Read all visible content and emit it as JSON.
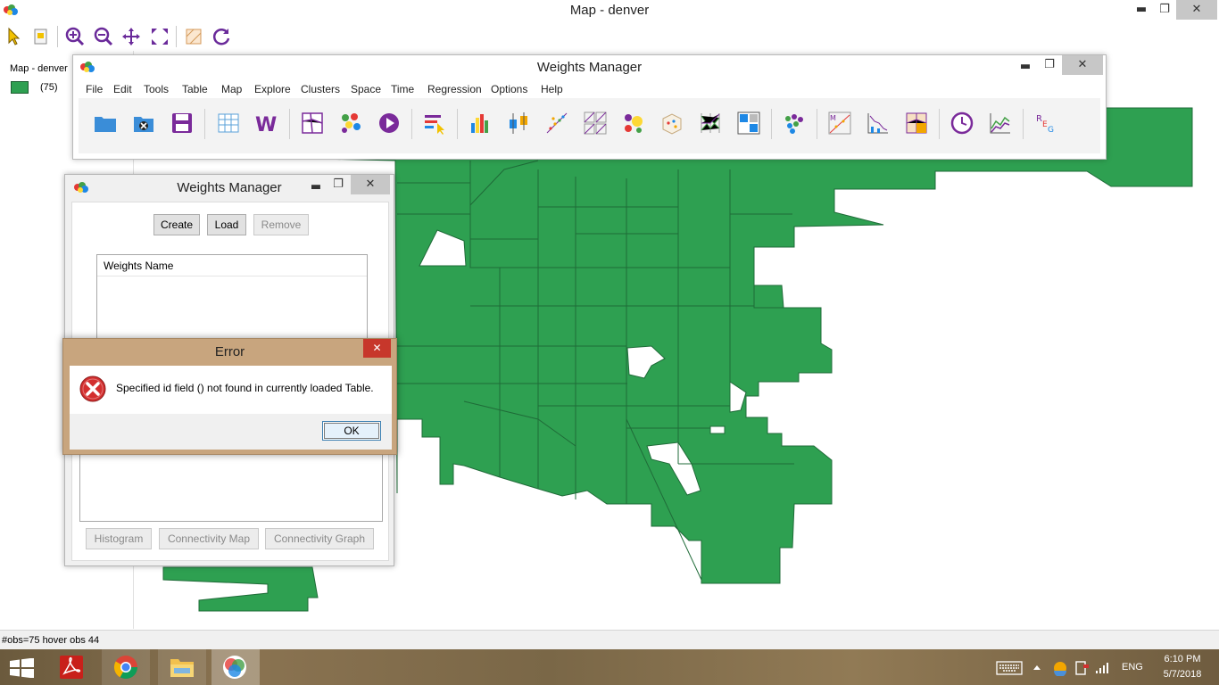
{
  "main_window": {
    "title": "Map - denver",
    "minimize": "▬",
    "restore": "❐",
    "close": "✕"
  },
  "legend": {
    "title": "Map - denver",
    "count": "(75)",
    "swatch_color": "#2ea051"
  },
  "status_bar": {
    "text": "#obs=75 hover obs 44"
  },
  "weights_manager_toolbar": {
    "title": "Weights Manager",
    "minimize": "▬",
    "restore": "❐",
    "close": "✕",
    "menu": [
      "File",
      "Edit",
      "Tools",
      "Table",
      "Map",
      "Explore",
      "Clusters",
      "Space",
      "Time",
      "Regression",
      "Options",
      "Help"
    ]
  },
  "weights_manager_dialog": {
    "title": "Weights Manager",
    "minimize": "▬",
    "restore": "❐",
    "close": "✕",
    "create_label": "Create",
    "load_label": "Load",
    "remove_label": "Remove",
    "list_header": "Weights Name",
    "histogram_label": "Histogram",
    "connectivity_map_label": "Connectivity Map",
    "connectivity_graph_label": "Connectivity Graph"
  },
  "error_dialog": {
    "title": "Error",
    "close": "✕",
    "message": "Specified id field () not found in currently loaded Table.",
    "ok_label": "OK"
  },
  "taskbar": {
    "language": "ENG",
    "time": "6:10 PM",
    "date": "5/7/2018"
  },
  "colors": {
    "map_fill": "#2ea051",
    "map_stroke": "#1f6b38",
    "error_frame": "#c8a57e",
    "close_red": "#c7372b"
  }
}
